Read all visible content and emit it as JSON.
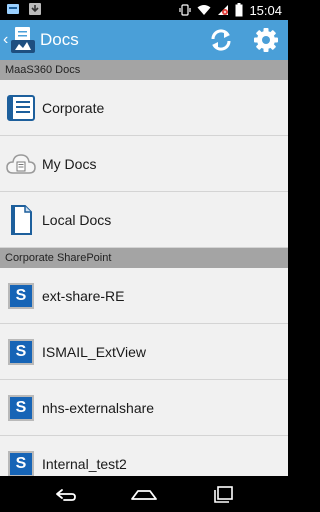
{
  "status_bar": {
    "time": "15:04",
    "icons": [
      "notification-icon",
      "download-icon",
      "vibrate-icon",
      "wifi-icon",
      "signal-icon",
      "battery-icon"
    ]
  },
  "action_bar": {
    "title": "Docs",
    "background_color": "#4a9fd8",
    "icons": [
      "up-caret-icon",
      "app-logo-icon",
      "refresh-icon",
      "settings-icon"
    ]
  },
  "sections": [
    {
      "header": "MaaS360 Docs",
      "items": [
        {
          "label": "Corporate",
          "icon": "corporate-docs-icon"
        },
        {
          "label": "My Docs",
          "icon": "cloud-icon"
        },
        {
          "label": "Local Docs",
          "icon": "document-icon"
        }
      ]
    },
    {
      "header": "Corporate SharePoint",
      "items": [
        {
          "label": "ext-share-RE",
          "icon": "sharepoint-icon"
        },
        {
          "label": "ISMAIL_ExtView",
          "icon": "sharepoint-icon"
        },
        {
          "label": "nhs-externalshare",
          "icon": "sharepoint-icon"
        },
        {
          "label": "Internal_test2",
          "icon": "sharepoint-icon"
        }
      ]
    }
  ],
  "sharepoint_badge_letter": "S",
  "colors": {
    "accent": "#4a9fd8",
    "section_header": "#a4a4a4",
    "list_background": "#f1f1f1",
    "sharepoint_blue": "#1664b6"
  },
  "nav_bar": {
    "icons": [
      "back-icon",
      "home-icon",
      "recent-apps-icon"
    ]
  }
}
